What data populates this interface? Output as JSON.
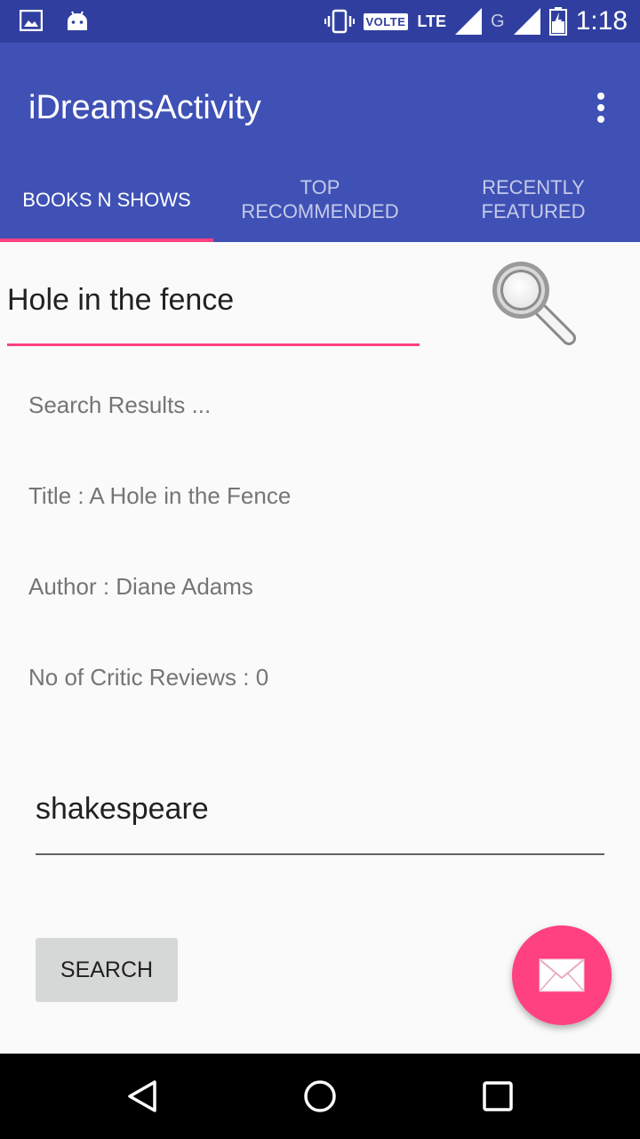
{
  "status_bar": {
    "time": "1:18",
    "volte": "VOLTE",
    "lte": "LTE",
    "network_g": "G"
  },
  "app_bar": {
    "title": "iDreamsActivity",
    "overflow_icon": "more-vert-icon"
  },
  "tabs": [
    {
      "label_line1": "BOOKS N SHOWS",
      "label_line2": "",
      "active": true
    },
    {
      "label_line1": "TOP",
      "label_line2": "RECOMMENDED",
      "active": false
    },
    {
      "label_line1": "RECENTLY",
      "label_line2": "FEATURED",
      "active": false
    }
  ],
  "search": {
    "query": "Hole in the fence",
    "icon": "search-icon"
  },
  "results": {
    "heading": "Search Results ...",
    "title": "Title : A Hole in the Fence",
    "author": "Author : Diane Adams",
    "reviews": "No of Critic Reviews : 0"
  },
  "second_search": {
    "value": "shakespeare",
    "button_label": "SEARCH"
  },
  "fab": {
    "icon": "mail-icon"
  },
  "colors": {
    "primary": "#3f51b5",
    "primary_dark": "#303f9f",
    "accent": "#ff4081"
  }
}
